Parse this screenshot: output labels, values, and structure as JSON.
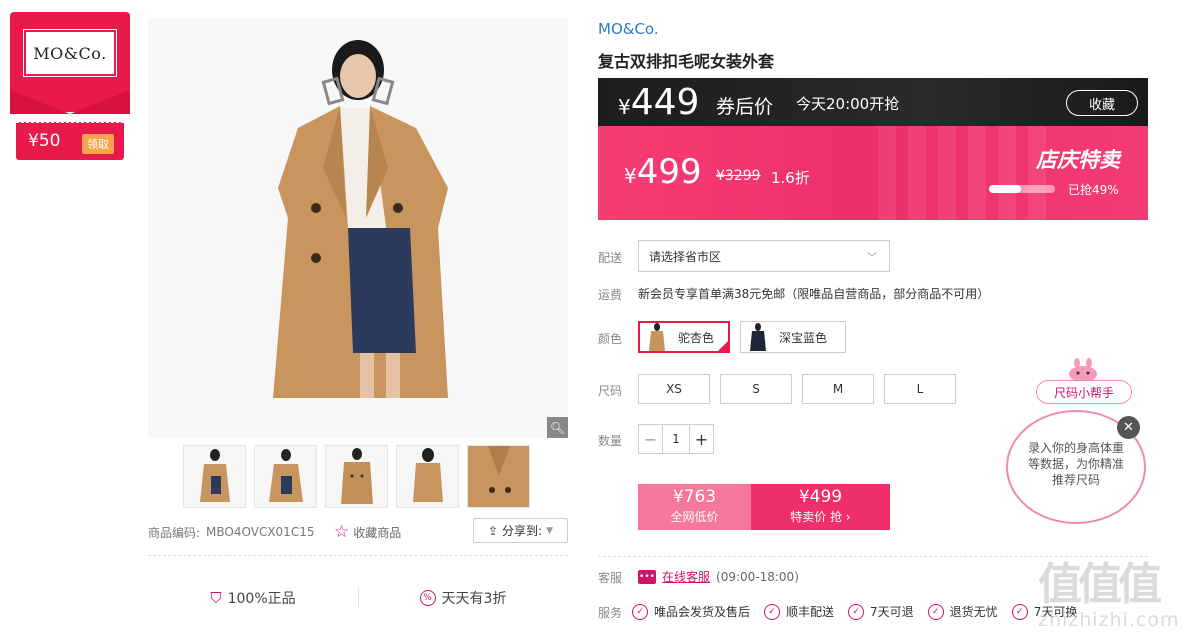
{
  "coupon": {
    "logo": "MO&Co.",
    "amount": "¥50",
    "claim_label": "领取"
  },
  "gallery": {
    "thumbnail_count": 5,
    "product_code_label": "商品编码:",
    "product_code": "MBO4OVCX01C15",
    "favorite_label": "收藏商品",
    "share_label": "分享到:"
  },
  "badges": {
    "authentic": "100%正品",
    "discount": "天天有3折"
  },
  "product": {
    "brand": "MO&Co.",
    "title": "复古双排扣毛呢女装外套"
  },
  "price_banner": {
    "coupon_price": "449",
    "coupon_price_label": "券后价",
    "start_time": "今天20:00开抢",
    "collect_label": "收藏",
    "sale_price": "499",
    "original_price": "¥3299",
    "discount": "1.6折",
    "event_label": "店庆特卖",
    "sold_percent": 49,
    "sold_text": "已抢49%"
  },
  "delivery": {
    "label": "配送",
    "select_value": "请选择省市区"
  },
  "shipping": {
    "label": "运费",
    "text": "新会员专享首单满38元免邮（限唯品自营商品，部分商品不可用）"
  },
  "colors": {
    "label": "颜色",
    "options": [
      {
        "name": "驼杏色",
        "selected": true
      },
      {
        "name": "深宝蓝色",
        "selected": false
      }
    ]
  },
  "sizes": {
    "label": "尺码",
    "options": [
      "XS",
      "S",
      "M",
      "L"
    ]
  },
  "quantity": {
    "label": "数量",
    "value": "1",
    "minus": "−",
    "plus": "+"
  },
  "buy": {
    "left_price": "¥763",
    "left_label": "全网低价",
    "right_price": "¥499",
    "right_label": "特卖价 抢 ›"
  },
  "service": {
    "cs_label": "客服",
    "chat_label": "在线客服",
    "hours": "(09:00-18:00)",
    "svc_label": "服务",
    "items": [
      "唯品会发货及售后",
      "顺丰配送",
      "7天可退",
      "退货无忧",
      "7天可换"
    ]
  },
  "size_helper": {
    "tag": "尺码小帮手",
    "text": "录入你的身高体重等数据，为你精准推荐尺码"
  },
  "watermark": {
    "big": "值值值",
    "small": "zhizhizhi.com"
  },
  "colors_theme": {
    "accent": "#e8194b",
    "link": "#2a7ac7",
    "dark_banner": "#1d1d1d"
  }
}
